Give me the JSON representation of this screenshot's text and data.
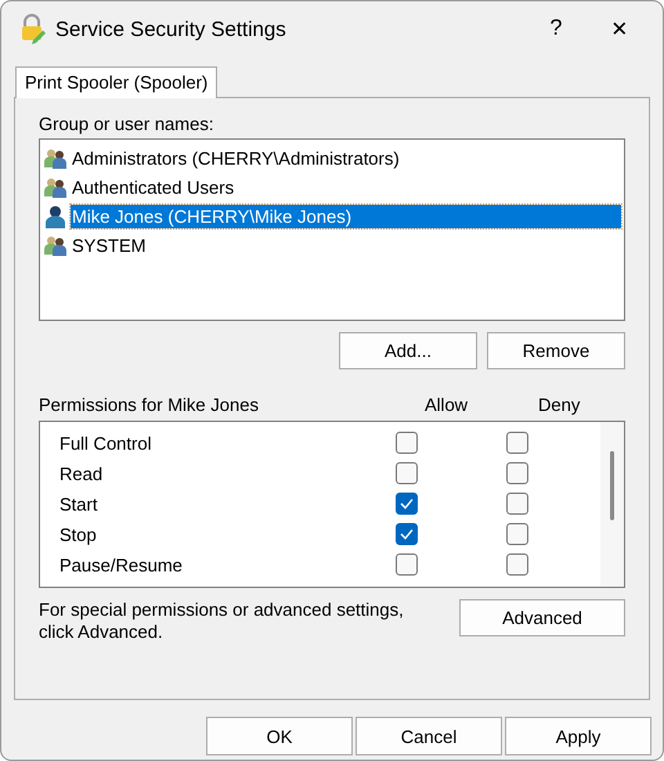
{
  "window": {
    "title": "Service Security Settings",
    "help": "?",
    "close": "✕"
  },
  "tabs": [
    {
      "label": "Print Spooler (Spooler)",
      "selected": true
    }
  ],
  "groups": {
    "label": "Group or user names:",
    "items": [
      {
        "name": "Administrators (CHERRY\\Administrators)",
        "kind": "group",
        "selected": false
      },
      {
        "name": "Authenticated Users",
        "kind": "group",
        "selected": false
      },
      {
        "name": "Mike Jones (CHERRY\\Mike Jones)",
        "kind": "user",
        "selected": true
      },
      {
        "name": "SYSTEM",
        "kind": "group",
        "selected": false
      }
    ]
  },
  "group_buttons": [
    {
      "label": "Add..."
    },
    {
      "label": "Remove"
    }
  ],
  "permissions": {
    "label": "Permissions for Mike Jones",
    "allow_header": "Allow",
    "deny_header": "Deny",
    "rows": [
      {
        "name": "Full Control",
        "allow": false,
        "deny": false
      },
      {
        "name": "Read",
        "allow": false,
        "deny": false
      },
      {
        "name": "Start",
        "allow": true,
        "deny": false
      },
      {
        "name": "Stop",
        "allow": true,
        "deny": false
      },
      {
        "name": "Pause/Resume",
        "allow": false,
        "deny": false
      }
    ]
  },
  "advanced": {
    "note": "For special permissions or advanced settings, click Advanced.",
    "button": "Advanced"
  },
  "buttons": [
    {
      "label": "OK"
    },
    {
      "label": "Cancel"
    },
    {
      "label": "Apply"
    }
  ]
}
